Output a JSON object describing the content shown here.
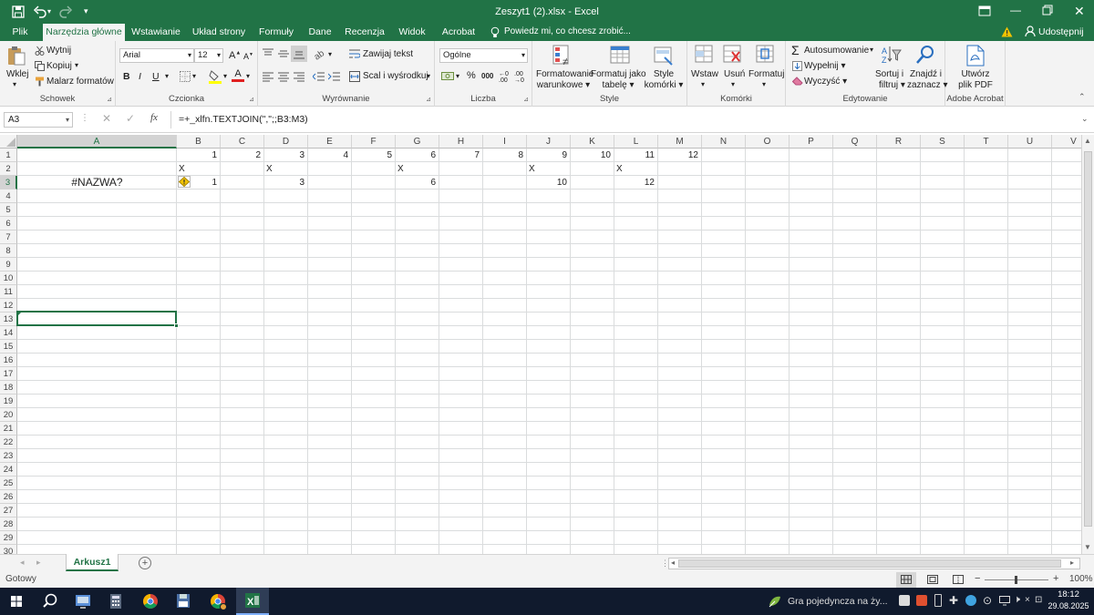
{
  "window": {
    "title": "Zeszyt1 (2).xlsx - Excel",
    "autosave_icon": "save-icon",
    "undo_icon": "undo-icon",
    "redo_icon": "redo-icon",
    "customize_icon": "chevron-down-icon"
  },
  "tabs": [
    {
      "label": "Plik",
      "active": false
    },
    {
      "label": "Narzędzia główne",
      "active": true
    },
    {
      "label": "Wstawianie",
      "active": false
    },
    {
      "label": "Układ strony",
      "active": false
    },
    {
      "label": "Formuły",
      "active": false
    },
    {
      "label": "Dane",
      "active": false
    },
    {
      "label": "Recenzja",
      "active": false
    },
    {
      "label": "Widok",
      "active": false
    },
    {
      "label": "Acrobat",
      "active": false
    }
  ],
  "tellme": "Powiedz mi, co chcesz zrobić...",
  "share_label": "Udostępnij",
  "ribbon": {
    "clipboard": {
      "label": "Schowek",
      "paste": "Wklej",
      "cut": "Wytnij",
      "copy": "Kopiuj",
      "format_painter": "Malarz formatów"
    },
    "font": {
      "label": "Czcionka",
      "font_name": "Arial",
      "font_size": "12",
      "bold": "B",
      "italic": "I",
      "underline": "U",
      "grow": "A",
      "shrink": "A",
      "font_color_letter": "A"
    },
    "alignment": {
      "label": "Wyrównanie",
      "wrap": "Zawijaj tekst",
      "merge": "Scal i wyśrodkuj"
    },
    "number": {
      "label": "Liczba",
      "format": "Ogólne",
      "percent": "%",
      "thousands": "000"
    },
    "styles": {
      "label": "Style",
      "conditional": [
        "Formatowanie",
        "warunkowe"
      ],
      "table": [
        "Formatuj jako",
        "tabelę"
      ],
      "cell_styles": [
        "Style",
        "komórki"
      ]
    },
    "cells": {
      "label": "Komórki",
      "insert": "Wstaw",
      "delete": "Usuń",
      "format": "Formatuj"
    },
    "editing": {
      "label": "Edytowanie",
      "autosum": "Autosumowanie",
      "fill": "Wypełnij",
      "clear": "Wyczyść",
      "sort": [
        "Sortuj i",
        "filtruj"
      ],
      "find": [
        "Znajdź i",
        "zaznacz"
      ]
    },
    "acrobat": {
      "label": "Adobe Acrobat",
      "create": [
        "Utwórz",
        "plik PDF"
      ]
    }
  },
  "formula_bar": {
    "name_box": "A3",
    "fx": "fx",
    "formula": "=+_xlfn.TEXTJOIN(\",\";;B3:M3)"
  },
  "columns": [
    "A",
    "B",
    "C",
    "D",
    "E",
    "F",
    "G",
    "H",
    "I",
    "J",
    "K",
    "L",
    "M",
    "N",
    "O",
    "P",
    "Q",
    "R",
    "S",
    "T",
    "U",
    "V"
  ],
  "rows": [
    "1",
    "2",
    "3",
    "4",
    "5",
    "6",
    "7",
    "8",
    "9",
    "10",
    "11",
    "12",
    "13",
    "14",
    "15",
    "16",
    "17",
    "18",
    "19",
    "20",
    "21",
    "22",
    "23",
    "24",
    "25",
    "26",
    "27",
    "28",
    "29",
    "30"
  ],
  "cells": {
    "row1": [
      "",
      "1",
      "2",
      "3",
      "4",
      "5",
      "6",
      "7",
      "8",
      "9",
      "10",
      "11",
      "12"
    ],
    "row2": [
      "",
      "X",
      "",
      "X",
      "",
      "",
      "X",
      "",
      "",
      "X",
      "",
      "X",
      ""
    ],
    "row3": [
      "#NAZWA?",
      "1",
      "",
      "3",
      "",
      "",
      "6",
      "",
      "",
      "10",
      "",
      "12"
    ]
  },
  "sheet_tab": "Arkusz1",
  "add_sheet": "+",
  "status": {
    "ready": "Gotowy",
    "zoom": "100%",
    "zoom_minus": "−",
    "zoom_plus": "+"
  },
  "taskbar": {
    "notification": "Gra pojedyncza na ży...",
    "time": "18:12",
    "date": "29.08.2025"
  },
  "colors": {
    "excel_green": "#217346",
    "ribbon_bg": "#f3f3f3",
    "taskbar_bg": "#101a2d"
  }
}
